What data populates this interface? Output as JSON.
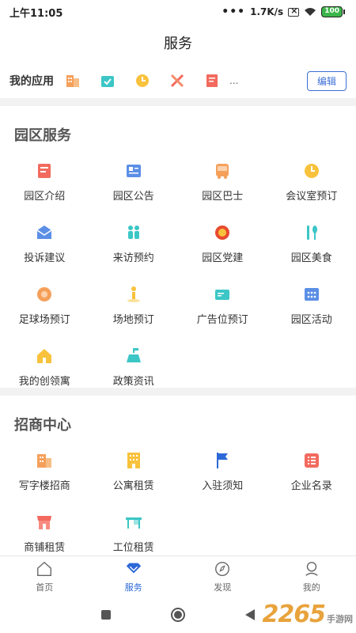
{
  "status_bar": {
    "time": "上午11:05",
    "dots": "•••",
    "speed": "1.7K/s",
    "battery": "100"
  },
  "header": {
    "title": "服务"
  },
  "my_apps": {
    "label": "我的应用",
    "icons": [
      "building-icon",
      "calendar-check-icon",
      "clock-icon",
      "tools-icon",
      "note-icon"
    ],
    "ellipsis": "...",
    "edit_label": "编辑"
  },
  "park_services": {
    "title": "园区服务",
    "items": [
      {
        "label": "园区介绍",
        "icon": "intro-icon"
      },
      {
        "label": "园区公告",
        "icon": "announcement-icon"
      },
      {
        "label": "园区巴士",
        "icon": "bus-icon"
      },
      {
        "label": "会议室预订",
        "icon": "clock-icon"
      },
      {
        "label": "投诉建议",
        "icon": "mail-icon"
      },
      {
        "label": "来访预约",
        "icon": "visitors-icon"
      },
      {
        "label": "园区党建",
        "icon": "party-icon"
      },
      {
        "label": "园区美食",
        "icon": "food-icon"
      },
      {
        "label": "足球场预订",
        "icon": "football-icon"
      },
      {
        "label": "场地预订",
        "icon": "venue-icon"
      },
      {
        "label": "广告位预订",
        "icon": "ad-card-icon"
      },
      {
        "label": "园区活动",
        "icon": "activity-icon"
      },
      {
        "label": "我的创领寓",
        "icon": "home-icon"
      },
      {
        "label": "政策资讯",
        "icon": "policy-icon"
      }
    ]
  },
  "investment_center": {
    "title": "招商中心",
    "items": [
      {
        "label": "写字楼招商",
        "icon": "office-building-icon"
      },
      {
        "label": "公寓租赁",
        "icon": "apartment-icon"
      },
      {
        "label": "入驻须知",
        "icon": "flag-icon"
      },
      {
        "label": "企业名录",
        "icon": "directory-icon"
      },
      {
        "label": "商铺租赁",
        "icon": "shop-icon"
      },
      {
        "label": "工位租赁",
        "icon": "desk-icon"
      }
    ]
  },
  "tabs": [
    {
      "label": "首页",
      "icon": "home-outline-icon",
      "active": false
    },
    {
      "label": "服务",
      "icon": "service-icon",
      "active": true
    },
    {
      "label": "发现",
      "icon": "compass-icon",
      "active": false
    },
    {
      "label": "我的",
      "icon": "user-icon",
      "active": false
    }
  ],
  "watermark": {
    "number": "2265",
    "text": "手游网"
  },
  "colors": {
    "accent": "#2c68d8",
    "orange": "#f5a05a",
    "teal": "#3cc6c6",
    "yellow": "#f8c23c",
    "red": "#f26a5e"
  }
}
